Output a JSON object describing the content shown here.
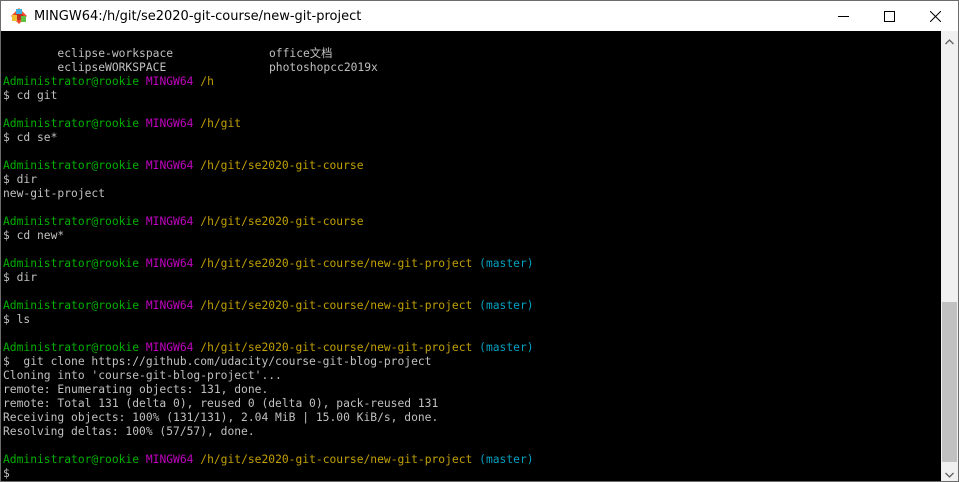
{
  "window": {
    "title": "MINGW64:/h/git/se2020-git-course/new-git-project"
  },
  "terminal": {
    "listing": [
      {
        "left": "eclipse-workspace",
        "right": "office文档"
      },
      {
        "left": "eclipseWORKSPACE",
        "right": "photoshopcc2019x"
      }
    ],
    "blocks": [
      {
        "prompt": {
          "user": "Administrator@rookie",
          "system": "MINGW64",
          "path": "/h",
          "branch": ""
        },
        "command": "$ cd git",
        "output": []
      },
      {
        "prompt": {
          "user": "Administrator@rookie",
          "system": "MINGW64",
          "path": "/h/git",
          "branch": ""
        },
        "command": "$ cd se*",
        "output": []
      },
      {
        "prompt": {
          "user": "Administrator@rookie",
          "system": "MINGW64",
          "path": "/h/git/se2020-git-course",
          "branch": ""
        },
        "command": "$ dir",
        "output": [
          "new-git-project"
        ]
      },
      {
        "prompt": {
          "user": "Administrator@rookie",
          "system": "MINGW64",
          "path": "/h/git/se2020-git-course",
          "branch": ""
        },
        "command": "$ cd new*",
        "output": []
      },
      {
        "prompt": {
          "user": "Administrator@rookie",
          "system": "MINGW64",
          "path": "/h/git/se2020-git-course/new-git-project",
          "branch": "(master)"
        },
        "command": "$ dir",
        "output": []
      },
      {
        "prompt": {
          "user": "Administrator@rookie",
          "system": "MINGW64",
          "path": "/h/git/se2020-git-course/new-git-project",
          "branch": "(master)"
        },
        "command": "$ ls",
        "output": []
      },
      {
        "prompt": {
          "user": "Administrator@rookie",
          "system": "MINGW64",
          "path": "/h/git/se2020-git-course/new-git-project",
          "branch": "(master)"
        },
        "command": "$  git clone https://github.com/udacity/course-git-blog-project",
        "output": [
          "Cloning into 'course-git-blog-project'...",
          "remote: Enumerating objects: 131, done.",
          "remote: Total 131 (delta 0), reused 0 (delta 0), pack-reused 131",
          "Receiving objects: 100% (131/131), 2.04 MiB | 15.00 KiB/s, done.",
          "Resolving deltas: 100% (57/57), done."
        ]
      }
    ],
    "final_prompt": {
      "user": "Administrator@rookie",
      "system": "MINGW64",
      "path": "/h/git/se2020-git-course/new-git-project",
      "branch": "(master)"
    },
    "input_line": "$ "
  },
  "icons": {
    "app": "git-bash-icon",
    "minimize": "minimize-icon",
    "maximize": "maximize-icon",
    "close": "close-icon",
    "scroll_up": "chevron-up-icon",
    "scroll_down": "chevron-down-icon"
  },
  "colors": {
    "background": "#000000",
    "text": "#c0c0c0",
    "user": "#00b000",
    "system": "#c000c0",
    "path": "#c0a000",
    "branch": "#00a0c0"
  }
}
